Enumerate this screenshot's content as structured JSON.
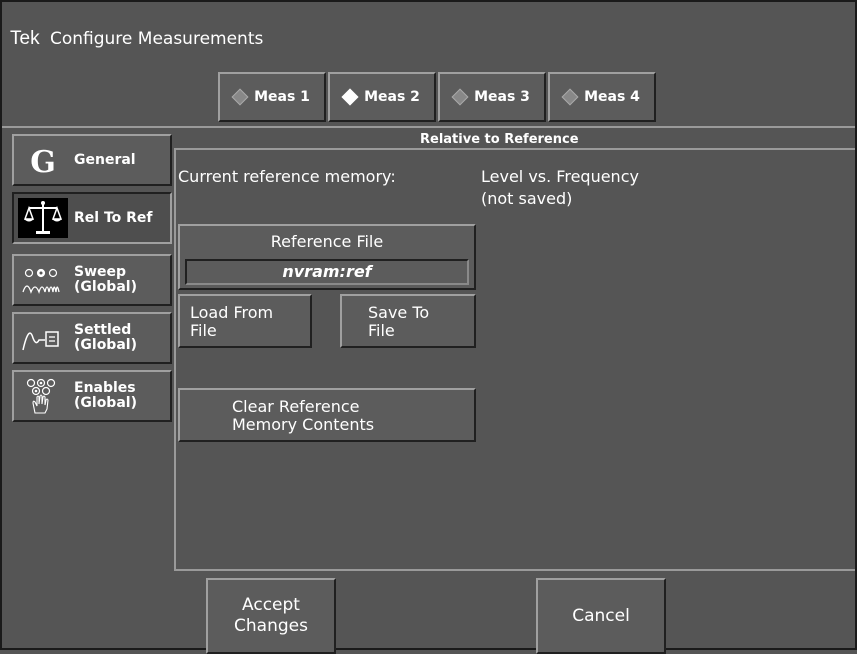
{
  "title": {
    "brand": "Tek",
    "text": "Configure Measurements"
  },
  "meas_tabs": [
    {
      "label": "Meas 1",
      "selected": false
    },
    {
      "label": "Meas 2",
      "selected": true
    },
    {
      "label": "Meas 3",
      "selected": false
    },
    {
      "label": "Meas 4",
      "selected": false
    }
  ],
  "nav": [
    {
      "label": "General",
      "icon": "g-letter-icon",
      "selected": false
    },
    {
      "label": "Rel To Ref",
      "icon": "scales-icon",
      "selected": true
    },
    {
      "label": "Sweep\n(Global)",
      "icon": "sweep-icon",
      "selected": false
    },
    {
      "label": "Settled\n(Global)",
      "icon": "settled-icon",
      "selected": false
    },
    {
      "label": "Enables\n(Global)",
      "icon": "enables-icon",
      "selected": false
    }
  ],
  "panel": {
    "title": "Relative to Reference",
    "current_label": "Current reference memory:",
    "current_value": "Level vs. Frequency",
    "current_note": "(not saved)",
    "ref_file_label": "Reference File",
    "ref_file_value": "nvram:ref",
    "load_label": "Load From\nFile",
    "save_label": "Save To\nFile",
    "clear_label": "Clear Reference\nMemory Contents"
  },
  "footer": {
    "accept_label": "Accept\nChanges",
    "cancel_label": "Cancel"
  },
  "colors": {
    "background": "#555555",
    "text": "#ffffff",
    "highlight": "#a0a0a0",
    "shadow": "#202020"
  }
}
